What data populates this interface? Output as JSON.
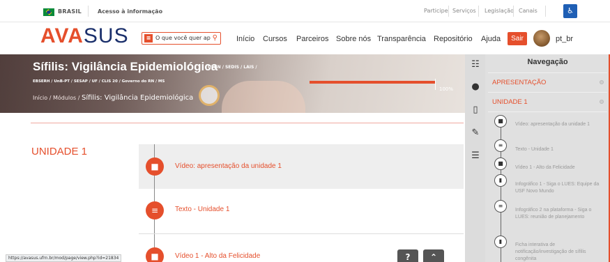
{
  "govbar": {
    "country": "BRASIL",
    "access_info": "Acesso à informação",
    "links": [
      "Participe",
      "Serviços",
      "Legislação",
      "Canais"
    ]
  },
  "header": {
    "logo_a": "AVA",
    "logo_b": "SUS",
    "search_placeholder": "O que você quer ap",
    "nav": [
      "Início",
      "Cursos",
      "Parceiros",
      "Sobre nós",
      "Transparência",
      "Repositório",
      "Ajuda"
    ],
    "logout": "Sair",
    "language": "pt_br"
  },
  "banner": {
    "title": "Sífilis: Vigilância Epidemiológica",
    "institutions": "UFRN / SEDIS / LAIS /",
    "subtitle": "EBSERH / UnB-PT / SESAP / UF / CLIS 20 / Governo do RN / MS",
    "breadcrumb_prefix": "Início / Módulos / ",
    "breadcrumb_current": "Sífilis: Vigilância Epidemiológica",
    "progress_label": "100%",
    "progress_value": 1.0
  },
  "main": {
    "unit_title": "UNIDADE 1",
    "activities": [
      {
        "label": "Vídeo: apresentação da unidade 1",
        "icon": "video-icon"
      },
      {
        "label": "Texto - Unidade 1",
        "icon": "text-icon"
      },
      {
        "label": "Vídeo 1 - Alto da Felicidade",
        "icon": "video-icon"
      }
    ]
  },
  "fab": {
    "help": "?",
    "top": "⌃"
  },
  "status_url": "https://avasus.ufrn.br/mod/page/view.php?id=21834",
  "navigation": {
    "title": "Navegação",
    "sections": [
      "APRESENTAÇÃO",
      "UNIDADE 1"
    ],
    "items": [
      {
        "label": "Vídeo: apresentação da unidade 1",
        "icon": "video-icon"
      },
      {
        "label": "Texto - Unidade 1",
        "icon": "text-icon"
      },
      {
        "label": "Vídeo 1 - Alto da Felicidade",
        "icon": "video-icon"
      },
      {
        "label": "Infográfico 1 - Siga o LUES: Equipe da USF Novo Mundo",
        "icon": "document-icon"
      },
      {
        "label": "Infográfico 2 na plataforma - Siga o LUES: reunião de planejamento",
        "icon": "text-icon"
      },
      {
        "label": "Ficha interativa de notificação/investigação de sífilis congênita",
        "icon": "document-icon"
      }
    ]
  },
  "colors": {
    "accent": "#e54f2c",
    "brand_dark": "#1a2f6b"
  }
}
